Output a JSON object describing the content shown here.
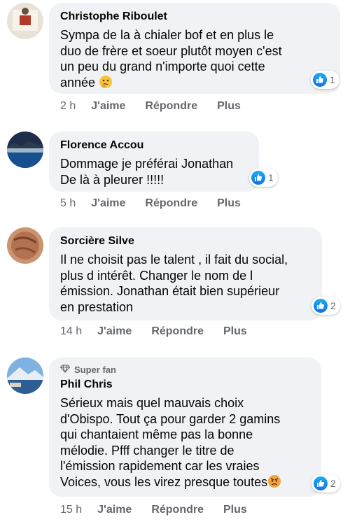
{
  "comments": [
    {
      "author": "Christophe Riboulet",
      "text": "Sympa de la à chialer bof et en plus le\nduo de frère et soeur plutôt moyen c'est\nun peu du grand n'importe quoi cette\nannée",
      "emoji": "thinking-face",
      "likes": "1",
      "time": "2 h",
      "like_label": "J'aime",
      "reply_label": "Répondre",
      "more_label": "Plus"
    },
    {
      "author": "Florence Accou",
      "text": "Dommage je préférai Jonathan\nDe là à pleurer !!!!!",
      "likes": "1",
      "time": "5 h",
      "like_label": "J'aime",
      "reply_label": "Répondre",
      "more_label": "Plus"
    },
    {
      "author": "Sorcière Silve",
      "text": "Il ne choisit pas le talent , il fait du social,\nplus d intérêt. Changer le nom de l\némission. Jonathan était bien supérieur\nen prestation",
      "likes": "2",
      "time": "14 h",
      "like_label": "J'aime",
      "reply_label": "Répondre",
      "more_label": "Plus"
    },
    {
      "badge": "Super fan",
      "author": "Phil Chris",
      "text": "Sérieux mais quel mauvais choix\nd'Obispo. Tout ça pour garder 2 gamins\nqui chantaient même pas la bonne\nmélodie. Pfff changer le titre de\nl'émission rapidement car les vraies\nVoices, vous les virez presque toutes",
      "emoji": "angry-face",
      "likes": "2",
      "time": "15 h",
      "like_label": "J'aime",
      "reply_label": "Répondre",
      "more_label": "Plus"
    }
  ],
  "colors": {
    "bubble": "#f0f2f5",
    "muted": "#65676b",
    "like_blue": "#1877f2"
  }
}
